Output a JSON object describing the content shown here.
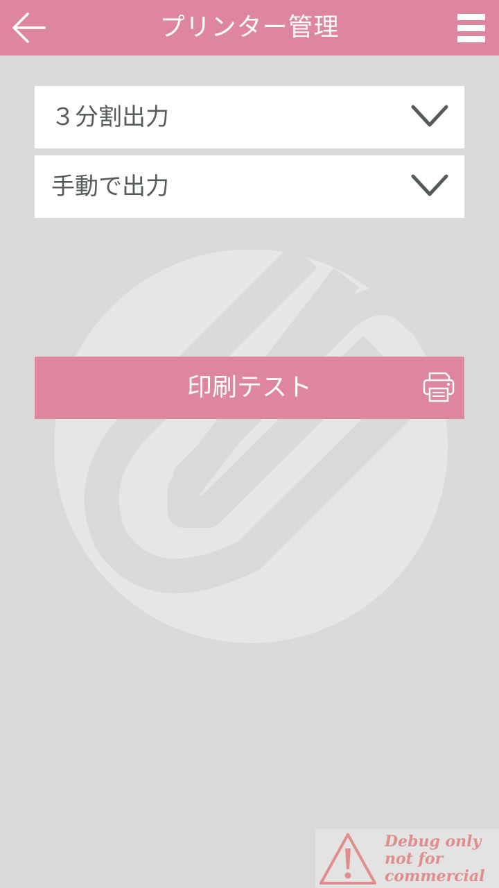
{
  "header": {
    "title": "プリンター管理",
    "back_icon": "arrow-left-icon",
    "menu_icon": "hamburger-menu-icon"
  },
  "selects": [
    {
      "value": "３分割出力",
      "icon": "chevron-down-icon"
    },
    {
      "value": "手動で出力",
      "icon": "chevron-down-icon"
    }
  ],
  "print_test": {
    "label": "印刷テスト",
    "icon": "printer-icon"
  },
  "debug_badge": {
    "line1": "Debug  only",
    "line2": "not for",
    "line3": "commercial",
    "icon": "warning-icon"
  },
  "colors": {
    "accent": "#de869e",
    "background": "#dadada",
    "card": "#ffffff",
    "text": "#555a5a",
    "watermark": "#e6e6e6",
    "debug_text": "#e08d8d"
  }
}
